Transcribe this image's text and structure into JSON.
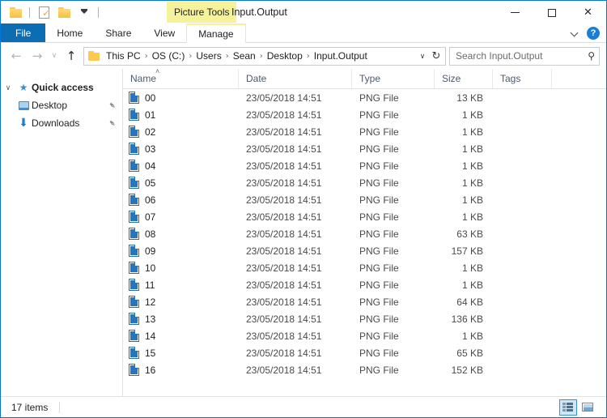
{
  "window": {
    "title": "Input.Output",
    "contextual_tab_group": "Picture Tools",
    "controls": {
      "minimize": "minimize-icon",
      "maximize": "maximize-icon",
      "close": "close-icon"
    }
  },
  "quick_access_toolbar": {
    "items": [
      {
        "name": "explorer-folder-icon",
        "glyph": "folder"
      },
      {
        "name": "properties-icon",
        "glyph": "properties"
      },
      {
        "name": "new-folder-icon",
        "glyph": "folder"
      },
      {
        "name": "customize-qat-dropdown",
        "glyph": "dropdown"
      }
    ]
  },
  "ribbon": {
    "tabs": [
      {
        "label": "File",
        "active": false,
        "style": "file"
      },
      {
        "label": "Home",
        "active": false,
        "style": "normal"
      },
      {
        "label": "Share",
        "active": false,
        "style": "normal"
      },
      {
        "label": "View",
        "active": false,
        "style": "normal"
      },
      {
        "label": "Manage",
        "active": true,
        "style": "normal"
      }
    ],
    "collapse_icon": "chevron-down-icon",
    "help_icon": "help-icon",
    "help_glyph": "?",
    "contextual_highlight_color": "#f5f29a",
    "file_tab_color": "#0d6db3"
  },
  "address_bar": {
    "back_icon": "back-arrow-icon",
    "back_glyph": "←",
    "forward_icon": "forward-arrow-icon",
    "forward_glyph": "→",
    "recent_icon": "recent-locations-icon",
    "recent_glyph": "∨",
    "up_icon": "up-arrow-icon",
    "up_glyph": "↑",
    "breadcrumbs": [
      "This PC",
      "OS (C:)",
      "Users",
      "Sean",
      "Desktop",
      "Input.Output"
    ],
    "separator_glyph": "›",
    "dropdown_icon": "address-dropdown-icon",
    "dropdown_glyph": "∨",
    "refresh_icon": "refresh-icon",
    "refresh_glyph": "↻"
  },
  "search": {
    "placeholder": "Search Input.Output",
    "value": "",
    "icon": "search-icon",
    "icon_glyph": "⚲"
  },
  "sidebar": {
    "groups": [
      {
        "label": "Quick access",
        "icon": "star-icon",
        "icon_glyph": "★",
        "expand_glyph": "∨",
        "items": [
          {
            "label": "Desktop",
            "icon": "monitor-icon",
            "pinned": true,
            "pin_glyph": "✒"
          },
          {
            "label": "Downloads",
            "icon": "download-arrow-icon",
            "pinned": true,
            "pin_glyph": "✒"
          }
        ]
      }
    ]
  },
  "file_list": {
    "columns": [
      {
        "key": "name",
        "label": "Name",
        "sorted": "asc",
        "sort_glyph": "˄"
      },
      {
        "key": "date",
        "label": "Date",
        "sorted": null
      },
      {
        "key": "type",
        "label": "Type",
        "sorted": null
      },
      {
        "key": "size",
        "label": "Size",
        "sorted": null
      },
      {
        "key": "tags",
        "label": "Tags",
        "sorted": null
      }
    ],
    "rows": [
      {
        "icon": "png-file-icon",
        "name": "00",
        "date": "23/05/2018 14:51",
        "type": "PNG File",
        "size": "13 KB",
        "tags": ""
      },
      {
        "icon": "png-file-icon",
        "name": "01",
        "date": "23/05/2018 14:51",
        "type": "PNG File",
        "size": "1 KB",
        "tags": ""
      },
      {
        "icon": "png-file-icon",
        "name": "02",
        "date": "23/05/2018 14:51",
        "type": "PNG File",
        "size": "1 KB",
        "tags": ""
      },
      {
        "icon": "png-file-icon",
        "name": "03",
        "date": "23/05/2018 14:51",
        "type": "PNG File",
        "size": "1 KB",
        "tags": ""
      },
      {
        "icon": "png-file-icon",
        "name": "04",
        "date": "23/05/2018 14:51",
        "type": "PNG File",
        "size": "1 KB",
        "tags": ""
      },
      {
        "icon": "png-file-icon",
        "name": "05",
        "date": "23/05/2018 14:51",
        "type": "PNG File",
        "size": "1 KB",
        "tags": ""
      },
      {
        "icon": "png-file-icon",
        "name": "06",
        "date": "23/05/2018 14:51",
        "type": "PNG File",
        "size": "1 KB",
        "tags": ""
      },
      {
        "icon": "png-file-icon",
        "name": "07",
        "date": "23/05/2018 14:51",
        "type": "PNG File",
        "size": "1 KB",
        "tags": ""
      },
      {
        "icon": "png-file-icon",
        "name": "08",
        "date": "23/05/2018 14:51",
        "type": "PNG File",
        "size": "63 KB",
        "tags": ""
      },
      {
        "icon": "png-file-icon",
        "name": "09",
        "date": "23/05/2018 14:51",
        "type": "PNG File",
        "size": "157 KB",
        "tags": ""
      },
      {
        "icon": "png-file-icon",
        "name": "10",
        "date": "23/05/2018 14:51",
        "type": "PNG File",
        "size": "1 KB",
        "tags": ""
      },
      {
        "icon": "png-file-icon",
        "name": "11",
        "date": "23/05/2018 14:51",
        "type": "PNG File",
        "size": "1 KB",
        "tags": ""
      },
      {
        "icon": "png-file-icon",
        "name": "12",
        "date": "23/05/2018 14:51",
        "type": "PNG File",
        "size": "64 KB",
        "tags": ""
      },
      {
        "icon": "png-file-icon",
        "name": "13",
        "date": "23/05/2018 14:51",
        "type": "PNG File",
        "size": "136 KB",
        "tags": ""
      },
      {
        "icon": "png-file-icon",
        "name": "14",
        "date": "23/05/2018 14:51",
        "type": "PNG File",
        "size": "1 KB",
        "tags": ""
      },
      {
        "icon": "png-file-icon",
        "name": "15",
        "date": "23/05/2018 14:51",
        "type": "PNG File",
        "size": "65 KB",
        "tags": ""
      },
      {
        "icon": "png-file-icon",
        "name": "16",
        "date": "23/05/2018 14:51",
        "type": "PNG File",
        "size": "152 KB",
        "tags": ""
      }
    ]
  },
  "status_bar": {
    "item_count_text": "17 items",
    "view_buttons": [
      {
        "name": "details-view-button",
        "selected": true
      },
      {
        "name": "large-icons-view-button",
        "selected": false
      }
    ]
  }
}
